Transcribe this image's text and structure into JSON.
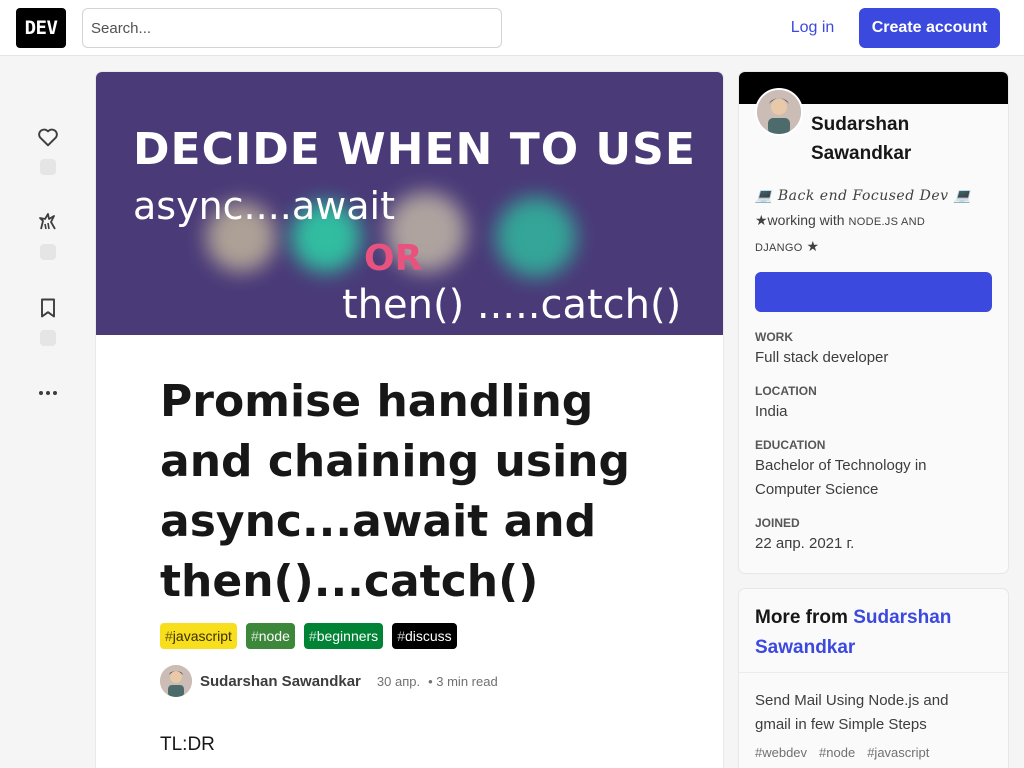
{
  "header": {
    "logo_text": "DEV",
    "search_placeholder": "Search...",
    "login_label": "Log in",
    "create_account_label": "Create account",
    "accent_color": "#3b49df"
  },
  "rail": {
    "icons": [
      "heart-icon",
      "unicorn-icon",
      "bookmark-icon",
      "more-icon"
    ]
  },
  "cover": {
    "line1": "DECIDE WHEN TO USE",
    "line2": "async....await",
    "line3": "OR",
    "line4": "then() .....catch()"
  },
  "post": {
    "title": "Promise handling and chaining using async...await and then()...catch()",
    "tags": [
      {
        "name": "javascript",
        "bg": "#f7df1e",
        "fg": "#3b2f00"
      },
      {
        "name": "node",
        "bg": "#3c873a",
        "fg": "#ffffff"
      },
      {
        "name": "beginners",
        "bg": "#008335",
        "fg": "#ffffff"
      },
      {
        "name": "discuss",
        "bg": "#000000",
        "fg": "#ffffff"
      }
    ],
    "author": "Sudarshan Sawandkar",
    "date": "30 апр.",
    "read_time": "• 3 min read",
    "body_start": "TL:DR"
  },
  "profile": {
    "name": "Sudarshan Sawandkar",
    "bio_line1": "💻 Back end Focused Dev 💻",
    "bio_line2_prefix": "★working with ",
    "bio_line2_sc": "NODE.JS AND",
    "bio_line3_sc": "DJANGO",
    "bio_line3_suffix": " ★",
    "work_label": "Work",
    "work": "Full stack developer",
    "location_label": "Location",
    "location": "India",
    "education_label": "Education",
    "education": "Bachelor of Technology in Computer Science",
    "joined_label": "Joined",
    "joined": "22 апр. 2021 г."
  },
  "more_from": {
    "prefix": "More from ",
    "author": "Sudarshan Sawandkar",
    "item_title": "Send Mail Using Node.js and gmail in few Simple Steps",
    "item_tags": [
      "#webdev",
      "#node",
      "#javascript"
    ]
  }
}
